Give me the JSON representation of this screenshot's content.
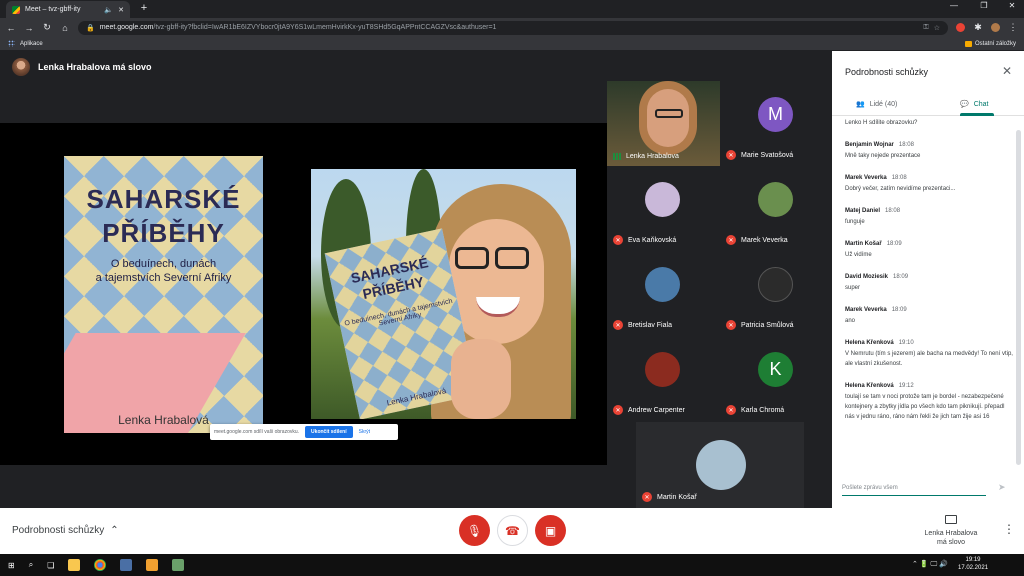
{
  "browser": {
    "tab_title": "Meet – tvz-gbff-ity",
    "url_host": "meet.google.com",
    "url_path": "/tvz-gbff-ity?fbclid=IwAR1bE6IZVYbocr0jtA9Y6S1wLmemHvirkKx-yuT8SHd5GqAPPntCCAGZVsc&authuser=1",
    "bookmarks_apps": "Aplikace",
    "bookmarks_other": "Ostatní záložky"
  },
  "meeting": {
    "speaker_banner": "Lenka Hrabalova má slovo",
    "share_notice": "meet.google.com sdílí vaši obrazovku.",
    "stop_share": "Ukončit sdílení",
    "hide": "Skrýt",
    "slide": {
      "book_title_1": "SAHARSKÉ",
      "book_title_2": "PŘÍBĚHY",
      "book_subtitle_1": "O beduínech, dunách",
      "book_subtitle_2": "a tajemstvích Severní Afriky",
      "book_author": "Lenka Hrabalová",
      "mini_title_1": "SAHARSKÉ",
      "mini_title_2": "PŘÍBĚHY",
      "mini_subtitle": "O beduínech, dunách a tajemstvích Severní Afriky",
      "mini_author": "Lenka Hrabalová"
    },
    "participants": [
      {
        "name": "Lenka Hrabalova"
      },
      {
        "name": "Marie Svatošová",
        "initial": "M",
        "color": "#7e57c2"
      },
      {
        "name": "Eva Kaňkovská",
        "color": "#c9b8d9"
      },
      {
        "name": "Marek Veverka",
        "color": "#6a8f4e"
      },
      {
        "name": "Bretislav Fiala",
        "color": "#4a7aa8"
      },
      {
        "name": "Patricia Smůlová",
        "color": "#2b2b2b"
      },
      {
        "name": "Andrew Carpenter",
        "color": "#8b2b1f"
      },
      {
        "name": "Karla Chromá",
        "initial": "K",
        "color": "#1e7e34"
      },
      {
        "name": "Martin Košař",
        "color": "#a8c0d0"
      }
    ]
  },
  "panel": {
    "title": "Podrobnosti schůzky",
    "tab_people": "Lidé (40)",
    "tab_chat": "Chat",
    "messages": [
      {
        "author": "",
        "time": "",
        "text": "Lenko H sdílite obrazovku?"
      },
      {
        "author": "Benjamin Wojnar",
        "time": "18:08",
        "text": "Mně taky nejede prezentace"
      },
      {
        "author": "Marek Veverka",
        "time": "18:08",
        "text": "Dobrý večer, zatím nevidíme prezentaci..."
      },
      {
        "author": "Matej Daniel",
        "time": "18:08",
        "text": "funguje"
      },
      {
        "author": "Martin Košař",
        "time": "18:09",
        "text": "Už vidíme"
      },
      {
        "author": "David Moziesik",
        "time": "18:09",
        "text": "super"
      },
      {
        "author": "Marek Veverka",
        "time": "18:09",
        "text": "ano"
      },
      {
        "author": "Helena Křenková",
        "time": "19:10",
        "text": "V Nemrutu (tím s jezerem) ale bacha na medvědy! To není vtip, ale vlastní zkušenost."
      },
      {
        "author": "Helena Křenková",
        "time": "19:12",
        "text": "toulají se tam v noci protože tam je bordel - nezabezpečené kontejnery a zbytky jídla po všech kdo tam piknikují. přepadl nás v jednu ráno, ráno nám řekli že jich tam žije asi 16"
      }
    ],
    "input_placeholder": "Pošlete zprávu všem"
  },
  "bottom": {
    "details": "Podrobnosti schůzky",
    "presenter_line1": "Lenka Hrabalova",
    "presenter_line2": "má slovo"
  },
  "taskbar": {
    "time": "19:19",
    "date": "17.02.2021"
  }
}
